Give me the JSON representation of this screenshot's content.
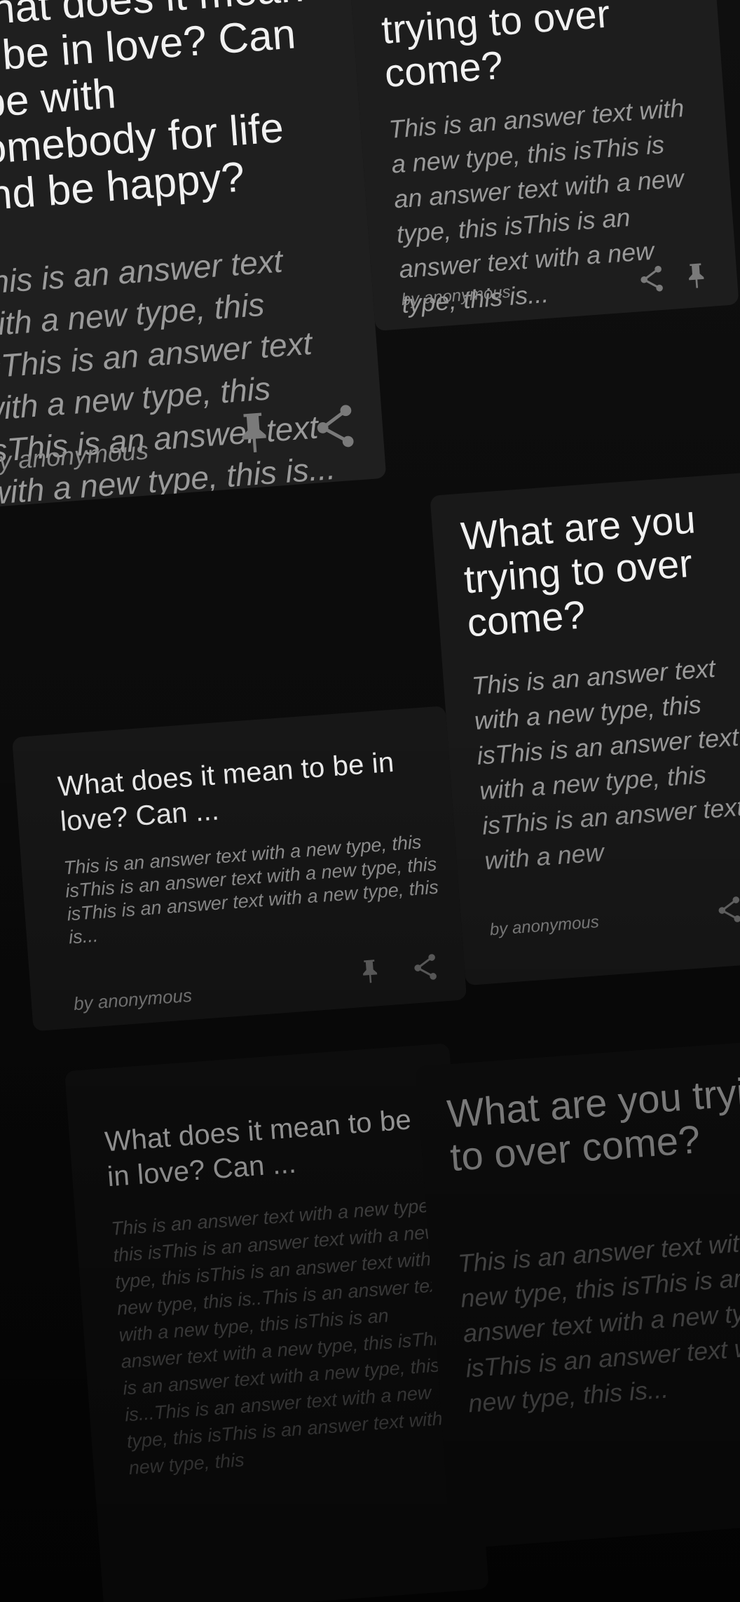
{
  "cards": [
    {
      "question": "What does it mean to be in love? Can I be with somebody for life and be happy?",
      "answer": "This is an answer text with a new type, this isThis is an answer text with a new type, this isThis is an answer text with a new type, this is...",
      "author": "by anonymous",
      "icons": [
        "pin-icon",
        "share-icon"
      ]
    },
    {
      "question": "What are you trying to over come?",
      "answer": "This is an answer text with a new type, this isThis is an answer text with a new type, this isThis is an answer text with a new type, this is...",
      "author": "by anonymous",
      "icons": [
        "share-icon",
        "pin-icon"
      ]
    },
    {
      "question": "What are you trying to over come?",
      "answer": "This is an answer text with a new type, this isThis is an answer text with a new type, this isThis is an answer text with a new",
      "author": "by anonymous",
      "icons": [
        "share-icon",
        "pin-icon"
      ]
    },
    {
      "question": "What does it mean to be in love? Can ...",
      "answer": "This is an answer text with a new type, this isThis is an answer text with a new type, this isThis is an answer text with a new type, this is...",
      "author": "by anonymous",
      "icons": [
        "pin-icon",
        "share-icon"
      ]
    },
    {
      "question": "What does it mean to be in love? Can ...",
      "answer": "This is an answer text with a new type, this isThis is an answer text with a new type, this isThis is an answer text with a new type, this is..This is an answer text with a new type, this isThis is an answer text with a new type, this isThis is an answer text with a new type, this is...This is an answer text with a new type, this isThis is an answer text with a new type, this"
    },
    {
      "question": "What are you trying to over come?",
      "answer": "This is an answer text with a new type, this isThis is an answer text with a new type, this isThis is an answer text with a new type, this is..."
    }
  ]
}
